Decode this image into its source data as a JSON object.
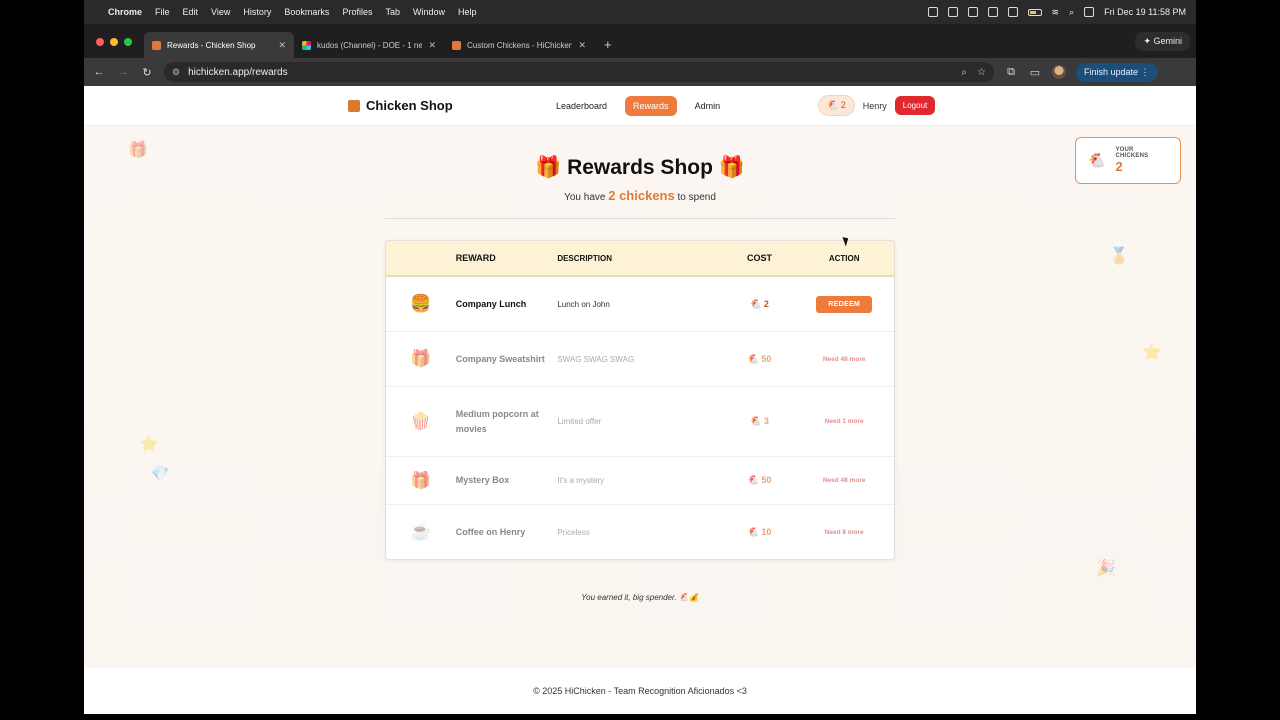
{
  "menubar": {
    "app": "Chrome",
    "items": [
      "File",
      "Edit",
      "View",
      "History",
      "Bookmarks",
      "Profiles",
      "Tab",
      "Window",
      "Help"
    ],
    "datetime": "Fri Dec 19  11:58 PM"
  },
  "browser": {
    "tabs": [
      {
        "label": "Rewards - Chicken Shop"
      },
      {
        "label": "kudos (Channel) - DOE - 1 new"
      },
      {
        "label": "Custom Chickens - HiChicken"
      }
    ],
    "gemini_label": "Gemini",
    "url": "hichicken.app/rewards",
    "finish_update": "Finish update"
  },
  "site": {
    "brand": "Chicken Shop",
    "nav": [
      "Leaderboard",
      "Rewards",
      "Admin"
    ],
    "chicken_count": "2",
    "username": "Henry",
    "logout": "Logout"
  },
  "your_chickens": {
    "label": "YOUR CHICKENS",
    "value": "2"
  },
  "heading": {
    "title": "Rewards Shop",
    "sub_pre": "You have",
    "amount": "2 chickens",
    "sub_post": "to spend"
  },
  "table": {
    "headers": {
      "reward": "REWARD",
      "description": "DESCRIPTION",
      "cost": "COST",
      "action": "ACTION"
    },
    "rows": [
      {
        "icon": "🍔",
        "name": "Company Lunch",
        "desc": "Lunch on John",
        "cost": "2",
        "action": "REDEEM"
      },
      {
        "icon": "🎁",
        "name": "Company Sweatshirt",
        "desc": "SWAG SWAG SWAG",
        "cost": "50",
        "action": "Need 48 more"
      },
      {
        "icon": "🍿",
        "name": "Medium popcorn at movies",
        "desc": "Limited offer",
        "cost": "3",
        "action": "Need 1 more"
      },
      {
        "icon": "🎁",
        "name": "Mystery Box",
        "desc": "It's a mystery",
        "cost": "50",
        "action": "Need 48 more"
      },
      {
        "icon": "☕",
        "name": "Coffee on Henry",
        "desc": "Priceless",
        "cost": "10",
        "action": "Need 8 more"
      }
    ]
  },
  "footnote": "You earned it, big spender. 🐔💰",
  "footer": "© 2025 HiChicken - Team Recognition Aficionados <3",
  "colors": {
    "accent": "#ee7a3c",
    "logout": "#e0292e",
    "header_bg": "#fdf2d6"
  }
}
